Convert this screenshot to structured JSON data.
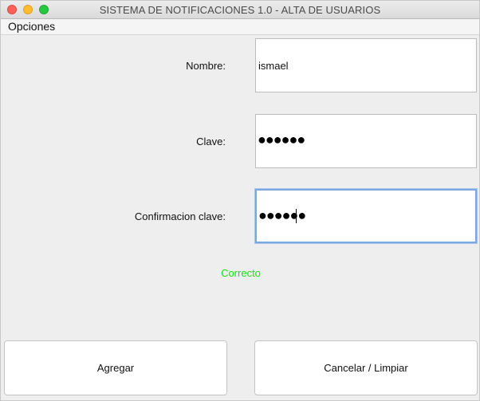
{
  "window": {
    "title": "SISTEMA DE NOTIFICACIONES 1.0 - ALTA DE USUARIOS"
  },
  "menu": {
    "items": [
      {
        "label": "Opciones"
      }
    ]
  },
  "form": {
    "nombre": {
      "label": "Nombre:",
      "value": "ismael"
    },
    "clave": {
      "label": "Clave:",
      "masked_value": "●●●●●●"
    },
    "confirmacion": {
      "label": "Confirmacion clave:",
      "masked_value": "●●●●●●"
    }
  },
  "status": {
    "text": "Correcto",
    "color": "#16e016"
  },
  "buttons": {
    "agregar": "Agregar",
    "cancelar": "Cancelar / Limpiar"
  }
}
